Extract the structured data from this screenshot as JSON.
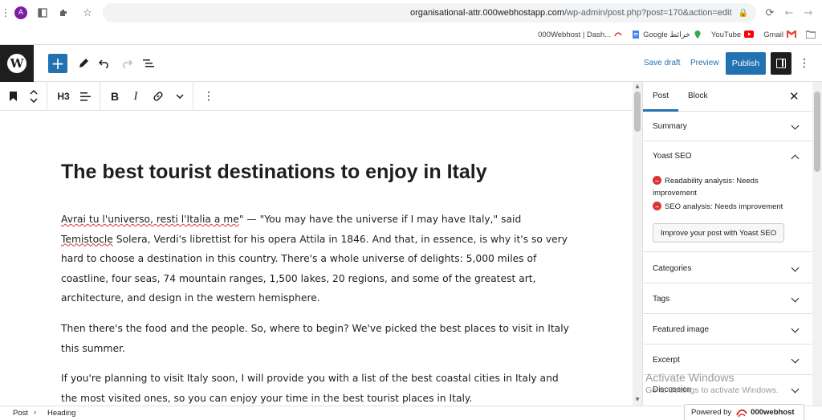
{
  "browser": {
    "avatar_letter": "A",
    "url_host": "organisational-attr.000webhostapp.com",
    "url_path": "/wp-admin/post.php?post=170&action=edit",
    "bookmarks": [
      {
        "label": "000Webhost | Dash..."
      },
      {
        "label": "Google خرائط"
      },
      {
        "label": "YouTube"
      },
      {
        "label": "Gmail"
      }
    ]
  },
  "header": {
    "save_draft": "Save draft",
    "preview": "Preview",
    "publish": "Publish"
  },
  "block_toolbar": {
    "heading_level": "H3"
  },
  "post": {
    "title": "The best tourist destinations to enjoy in Italy",
    "p1_a": "Avrai tu l'universo, resti l'Italia a me",
    "p1_b": "\" — \"You may have the universe if I may have Italy,\" said ",
    "p1_c": "Temistocle",
    "p1_d": " Solera, Verdi's librettist for his opera Attila in 1846. And that, in essence, is why it's so very hard to choose a destination in this country. There's a whole universe of delights: 5,000 miles of coastline, four seas, 74 mountain ranges, 1,500 lakes, 20 regions, and some of the greatest art, architecture, and design in the western hemisphere.",
    "p2": "Then there's the food and the people. So, where to begin? We've picked the best places to visit in Italy this summer.",
    "p3": "If you're planning to visit Italy soon, I will provide you with a list of the best coastal cities in Italy and the most visited ones, so you can enjoy your time in the best tourist places in Italy."
  },
  "sidebar": {
    "tabs": [
      "Post",
      "Block"
    ],
    "panels": {
      "summary": "Summary",
      "yoast": "Yoast SEO",
      "readability_label": "Readability analysis:",
      "readability_value": "Needs improvement",
      "seo_label": "SEO analysis:",
      "seo_value": "Needs improvement",
      "yoast_button": "Improve your post with Yoast SEO",
      "categories": "Categories",
      "tags": "Tags",
      "featured_image": "Featured image",
      "excerpt": "Excerpt",
      "discussion": "Discussion"
    }
  },
  "watermark": {
    "line1": "Activate Windows",
    "line2": "Go to Settings to activate Windows."
  },
  "footer": {
    "crumb_1": "Post",
    "crumb_2": "Heading",
    "powered_by": "Powered by",
    "brand": "000webhost"
  },
  "colors": {
    "accent": "#2271b1",
    "dark": "#1e1e1e",
    "error": "#dc3232"
  }
}
